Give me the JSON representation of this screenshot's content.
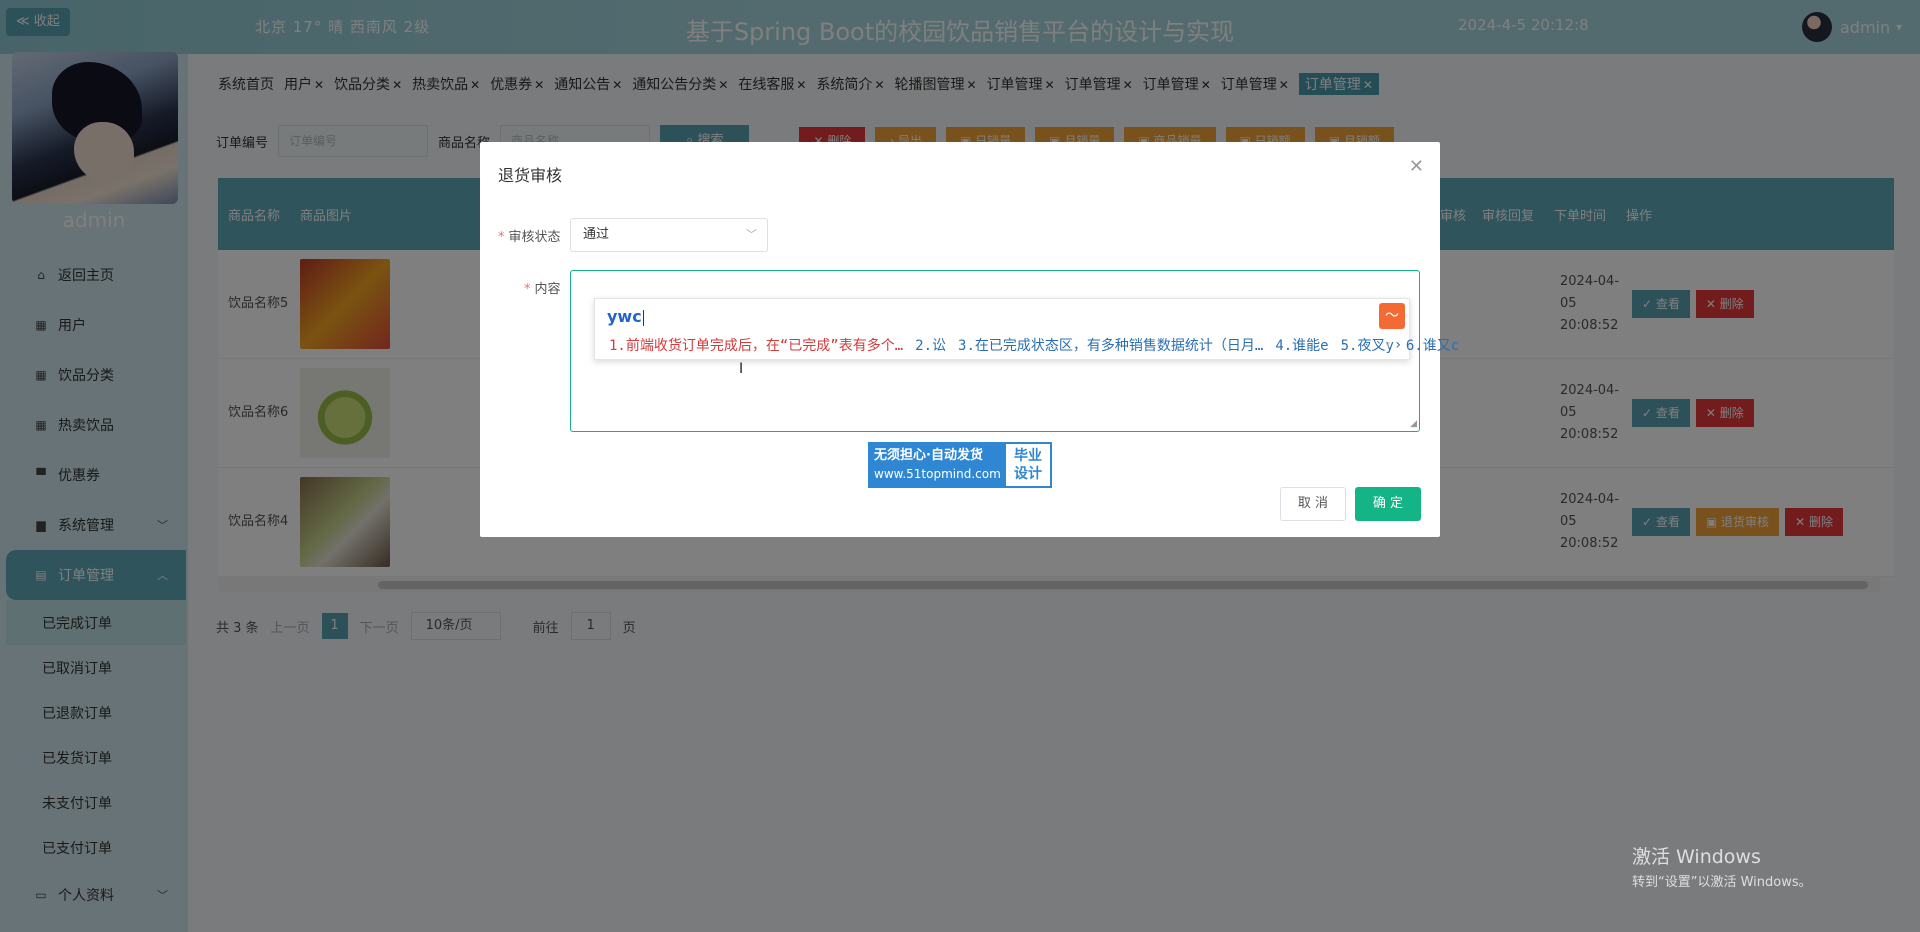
{
  "header": {
    "collapse_label": "≪ 收起",
    "weather": "北京  17°  晴  西南风  2级",
    "title": "基于Spring Boot的校园饮品销售平台的设计与实现",
    "datetime": "2024-4-5 20:12:8",
    "username": "admin"
  },
  "sidebar": {
    "username": "admin",
    "items": [
      {
        "label": "返回主页",
        "icon": "home-icon"
      },
      {
        "label": "用户",
        "icon": "grid-icon"
      },
      {
        "label": "饮品分类",
        "icon": "grid-icon"
      },
      {
        "label": "热卖饮品",
        "icon": "grid-icon"
      },
      {
        "label": "优惠券",
        "icon": "monitor-icon"
      },
      {
        "label": "系统管理",
        "icon": "briefcase-icon"
      },
      {
        "label": "订单管理",
        "icon": "clipboard-icon"
      }
    ],
    "submenu": [
      "已完成订单",
      "已取消订单",
      "已退款订单",
      "已发货订单",
      "未支付订单",
      "已支付订单"
    ],
    "profile": "个人资料"
  },
  "tabs": [
    "系统首页",
    "用户",
    "饮品分类",
    "热卖饮品",
    "优惠券",
    "通知公告",
    "通知公告分类",
    "在线客服",
    "系统简介",
    "轮播图管理",
    "订单管理",
    "订单管理",
    "订单管理",
    "订单管理",
    "订单管理"
  ],
  "search": {
    "order_no_label": "订单编号",
    "order_no_placeholder": "订单编号",
    "product_label": "商品名称",
    "product_placeholder": "商品名称",
    "search_btn": "搜索",
    "ops": [
      "删除",
      "导出",
      "日销量",
      "月销量",
      "商品销量",
      "日销额",
      "月销额"
    ]
  },
  "table": {
    "headers": [
      "商品名称",
      "商品图片",
      "审核",
      "审核回复",
      "下单时间",
      "操作"
    ],
    "rows": [
      {
        "name": "饮品名称5",
        "time": "2024-04-05 20:08:52",
        "ops": [
          "查看",
          "删除"
        ]
      },
      {
        "name": "饮品名称6",
        "time": "2024-04-05 20:08:52",
        "ops": [
          "查看",
          "删除"
        ]
      },
      {
        "name": "饮品名称4",
        "time": "2024-04-05 20:08:52",
        "ops": [
          "查看",
          "退货审核",
          "删除"
        ]
      }
    ]
  },
  "pager": {
    "total": "共 3 条",
    "prev": "上一页",
    "page": "1",
    "next": "下一页",
    "size": "10条/页",
    "goto": "前往",
    "goto_value": "1",
    "page_unit": "页"
  },
  "dialog": {
    "title": "退货审核",
    "status_label": "审核状态",
    "status_value": "通过",
    "content_label": "内容",
    "cancel": "取 消",
    "confirm": "确 定",
    "ad": {
      "line1": "无须担心·自动发货",
      "line2": "www.51topmind.com",
      "right1": "毕业",
      "right2": "设计"
    }
  },
  "ime": {
    "composition": "ywc",
    "candidates": [
      "1.前端收货订单完成后，在“已完成”表有多个…",
      "2.讼",
      "3.在已完成状态区，有多种销售数据统计（日月…",
      "4.谁能e",
      "5.夜叉y",
      "6.谁又c"
    ]
  },
  "watermark": {
    "line1": "激活 Windows",
    "line2": "转到“设置”以激活 Windows。"
  }
}
